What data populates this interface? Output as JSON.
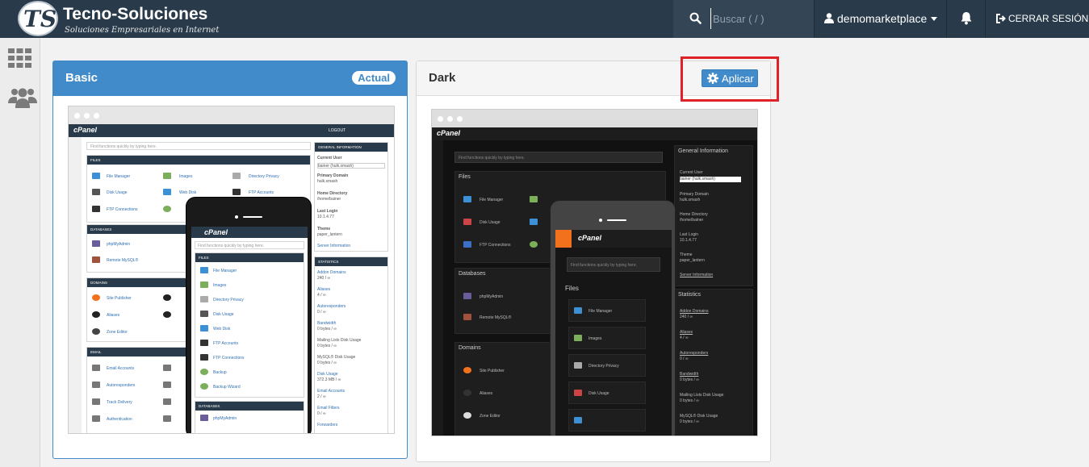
{
  "header": {
    "logo_initials": "TS",
    "brand_name": "Tecno-Soluciones",
    "brand_tagline": "Soluciones Empresariales en Internet",
    "search_placeholder": "Buscar ( / )",
    "username": "demomarketplace",
    "logout_label": "CERRAR SESIÓN"
  },
  "themes": [
    {
      "name": "Basic",
      "badge": "Actual"
    },
    {
      "name": "Dark",
      "action_label": "Aplicar"
    }
  ],
  "preview": {
    "brand": "cPanel",
    "search_hint": "Find functions quickly by typing here.",
    "logout": "LOGOUT",
    "sections": {
      "files": "FILES",
      "databases": "DATABASES",
      "domains": "DOMAINS",
      "email": "EMAIL"
    },
    "dark_sections": {
      "files": "Files",
      "databases": "Databases",
      "domains": "Domains"
    },
    "files_items": [
      "File Manager",
      "Images",
      "Directory Privacy",
      "Disk Usage",
      "Web Disk",
      "FTP Accounts",
      "FTP Connections",
      "Backup"
    ],
    "db_items": [
      "phpMyAdmin",
      "Remote MySQL®"
    ],
    "domain_items": [
      "Site Publisher",
      "Aliases",
      "Zone Editor"
    ],
    "email_items": [
      "Email Accounts",
      "Autoresponders",
      "Track Delivery",
      "Authentication"
    ],
    "mobile_items": [
      "File Manager",
      "Images",
      "Directory Privacy",
      "Disk Usage",
      "Web Disk",
      "FTP Accounts",
      "FTP Connections",
      "Backup",
      "Backup Wizard"
    ],
    "mobile_db_item": "phpMyAdmin",
    "dark_mobile_items": [
      "File Manager",
      "Images",
      "Directory Privacy",
      "Disk Usage"
    ],
    "general_info": {
      "title": "GENERAL INFORMATION",
      "dark_title": "General Information",
      "current_user_label": "Current User",
      "current_user_value": "bainer (hulk.smash)",
      "primary_domain_label": "Primary Domain",
      "primary_domain_value": "hulk.smash",
      "home_dir_label": "Home Directory",
      "home_dir_value": "/home/bainer",
      "last_login_label": "Last Login",
      "last_login_value": "10.1.4.77",
      "theme_label": "Theme",
      "theme_value": "paper_lantern",
      "server_info_link": "Server Information"
    },
    "stats": {
      "title": "STATISTICS",
      "dark_title": "Statistics",
      "items": [
        {
          "label": "Addon Domains",
          "value": "240 / ∞"
        },
        {
          "label": "Aliases",
          "value": "4 / ∞"
        },
        {
          "label": "Autoresponders",
          "value": "0 / ∞"
        },
        {
          "label": "Bandwidth",
          "value": "0 bytes / ∞"
        },
        {
          "label": "Mailing Lists Disk Usage",
          "value": "0 bytes / ∞"
        },
        {
          "label": "MySQL® Disk Usage",
          "value": "0 bytes / ∞"
        },
        {
          "label": "Disk Usage",
          "value": "372.3 MB / ∞"
        },
        {
          "label": "Email Accounts",
          "value": "2 / ∞"
        },
        {
          "label": "Email Filters",
          "value": "0 / ∞"
        },
        {
          "label": "Forwarders",
          "value": ""
        }
      ]
    }
  },
  "colors": {
    "topbar": "#293a4a",
    "primary": "#428bca",
    "highlight": "#e02127"
  }
}
